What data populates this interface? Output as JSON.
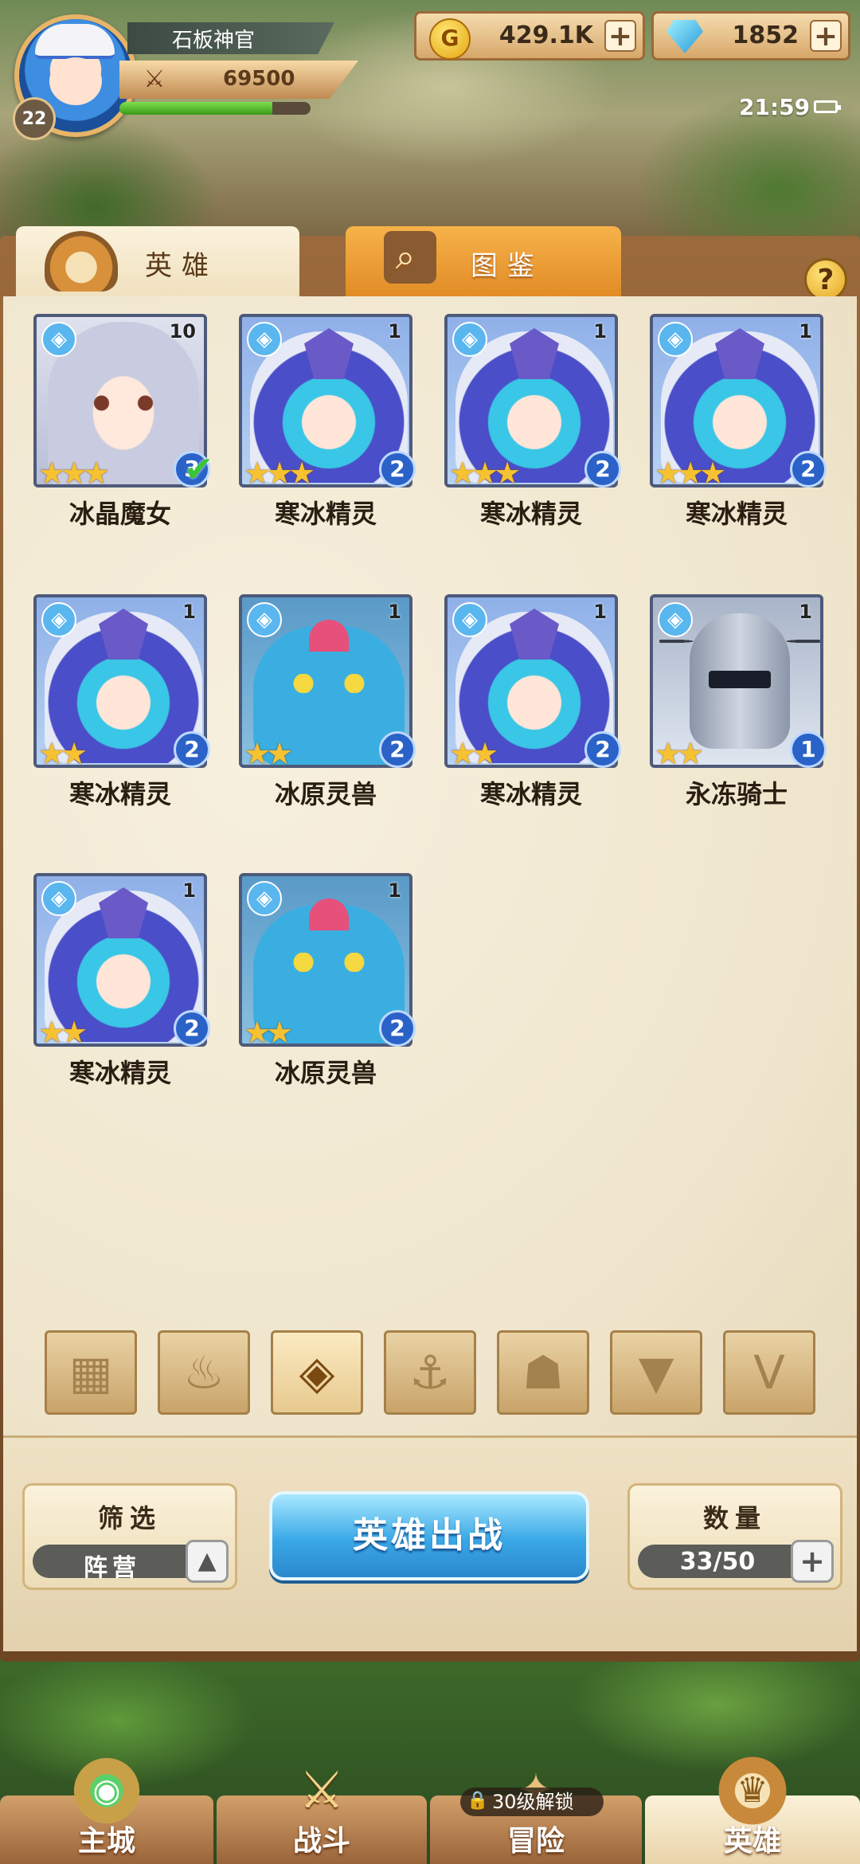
{
  "player": {
    "name": "石板神官",
    "level": "22",
    "power": "69500",
    "xp_fraction": 0.8
  },
  "currency": {
    "gold": "429.1K",
    "gems": "1852",
    "gold_icon_glyph": "G"
  },
  "status": {
    "time": "21:59"
  },
  "tabs": [
    {
      "label": "英雄"
    },
    {
      "label": "图鉴"
    }
  ],
  "help_label": "?",
  "heroes": [
    {
      "name": "冰晶魔女",
      "count": "10",
      "stars": "★★★",
      "tier": "3",
      "checked": true
    },
    {
      "name": "寒冰精灵",
      "count": "1",
      "stars": "★★★",
      "tier": "2"
    },
    {
      "name": "寒冰精灵",
      "count": "1",
      "stars": "★★★",
      "tier": "2"
    },
    {
      "name": "寒冰精灵",
      "count": "1",
      "stars": "★★★",
      "tier": "2"
    },
    {
      "name": "寒冰精灵",
      "count": "1",
      "stars": "★★",
      "tier": "2"
    },
    {
      "name": "冰原灵兽",
      "count": "1",
      "stars": "★★",
      "tier": "2"
    },
    {
      "name": "寒冰精灵",
      "count": "1",
      "stars": "★★",
      "tier": "2"
    },
    {
      "name": "永冻骑士",
      "count": "1",
      "stars": "★★",
      "tier": "1"
    },
    {
      "name": "寒冰精灵",
      "count": "1",
      "stars": "★★",
      "tier": "2"
    },
    {
      "name": "冰原灵兽",
      "count": "1",
      "stars": "★★",
      "tier": "2"
    }
  ],
  "faction_filters": [
    {
      "icon": "grid-icon",
      "glyph": "▦"
    },
    {
      "icon": "flame-icon",
      "glyph": "♨"
    },
    {
      "icon": "ice-faction-icon",
      "glyph": "◈"
    },
    {
      "icon": "anchor-icon",
      "glyph": "⚓"
    },
    {
      "icon": "beast-icon",
      "glyph": "☗"
    },
    {
      "icon": "demon-icon",
      "glyph": "▼"
    },
    {
      "icon": "horn-icon",
      "glyph": "V"
    }
  ],
  "filter": {
    "title": "筛选",
    "value": "阵营",
    "toggle_glyph": "▲"
  },
  "deploy_label": "英雄出战",
  "quantity": {
    "title": "数量",
    "value": "33/50",
    "add_glyph": "+"
  },
  "nav": [
    {
      "label": "主城"
    },
    {
      "label": "战斗"
    },
    {
      "label": "冒险",
      "lock_text": "30级解锁"
    },
    {
      "label": "英雄"
    }
  ]
}
